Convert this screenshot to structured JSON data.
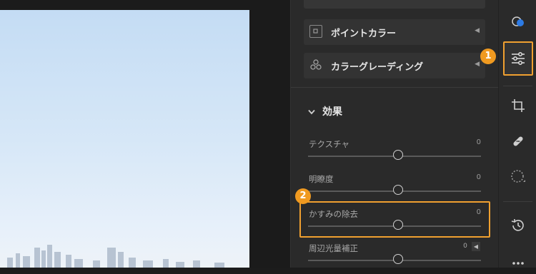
{
  "panel": {
    "items": [
      {
        "label": "ポイントカラー",
        "icon": "point-color-icon"
      },
      {
        "label": "カラーグレーディング",
        "icon": "color-grading-icon"
      }
    ],
    "section": {
      "title": "効果"
    },
    "sliders": [
      {
        "name": "テクスチャ",
        "value": "0",
        "level": 0
      },
      {
        "name": "明瞭度",
        "value": "0",
        "level": 0
      },
      {
        "name": "かすみの除去",
        "value": "0",
        "level": 0
      },
      {
        "name": "周辺光量補正",
        "value": "0",
        "level": 0
      }
    ]
  },
  "annotations": {
    "badge1": "1",
    "badge2": "2",
    "highlight_color": "#f0a030"
  },
  "toolbar": {
    "tools": [
      "masking-icon",
      "edit-adjust-icon",
      "crop-icon",
      "heal-icon",
      "selection-icon",
      "history-icon",
      "more-icon"
    ],
    "accent": "#2d7be5"
  }
}
